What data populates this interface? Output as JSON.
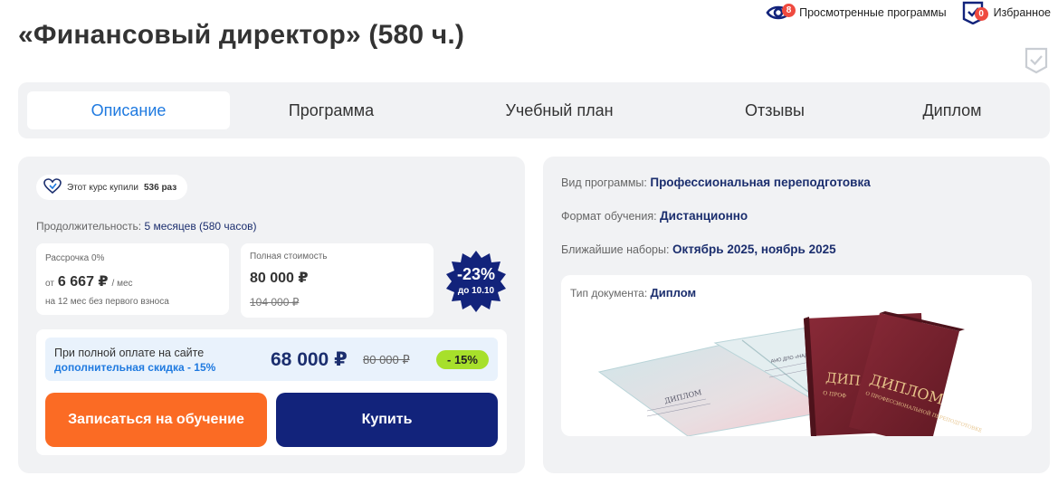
{
  "page": {
    "title": "«Финансовый директор» (580 ч.)"
  },
  "top_links": {
    "viewed": {
      "label": "Просмотренные программы",
      "count": "8"
    },
    "favorites": {
      "label": "Избранное",
      "count": "0"
    }
  },
  "tabs": [
    {
      "label": "Описание",
      "active": true
    },
    {
      "label": "Программа",
      "active": false
    },
    {
      "label": "Учебный план",
      "active": false
    },
    {
      "label": "Отзывы",
      "active": false
    },
    {
      "label": "Диплом",
      "active": false
    }
  ],
  "left": {
    "bought_prefix": "Этот курс купили",
    "bought_count": "536 раз",
    "duration_label": "Продолжительность:",
    "duration_value": "5 месяцев (580 часов)",
    "installment": {
      "title": "Рассрочка 0%",
      "from": "от",
      "amount": "6 667 ₽",
      "per": "/ мес",
      "note": "на 12 мес без первого взноса"
    },
    "full_price": {
      "title": "Полная стоимость",
      "amount": "80 000 ₽",
      "old": "104 000 ₽"
    },
    "discount_badge": {
      "percent": "-23%",
      "until": "до 10.10"
    },
    "promo": {
      "line1": "При полной оплате на сайте",
      "line2": "дополнительная скидка - 15%",
      "price": "68 000 ₽",
      "old_price": "80 000 ₽",
      "percent": "- 15%"
    },
    "buttons": {
      "enroll": "Записаться на обучение",
      "buy": "Купить"
    }
  },
  "right": {
    "program_type_label": "Вид программы:",
    "program_type_value": "Профессиональная переподготовка",
    "format_label": "Формат обучения:",
    "format_value": "Дистанционно",
    "intake_label": "Ближайшие наборы:",
    "intake_value": "Октябрь 2025, ноябрь 2025",
    "doc_label": "Тип документа:",
    "doc_value": "Диплом",
    "diploma_insert_title": "ДИПЛОМ",
    "diploma_insert_org": "АНО ДПО «НАДПО»",
    "diploma_cover_front": "ДИПЛОМ",
    "diploma_cover_front_sub": "О ПРОФЕССИОНАЛЬНОЙ ПЕРЕПОДГОТОВКЕ",
    "diploma_cover_back": "ДИПЛ",
    "diploma_cover_back_sub": "О ПРОФ"
  },
  "colors": {
    "accent_blue": "#1f7ae0",
    "navy": "#12237b",
    "orange": "#fb6b24",
    "green_badge": "#a7e02b",
    "badge_red": "#ef4a3f",
    "diploma_burgundy": "#7b2230"
  }
}
